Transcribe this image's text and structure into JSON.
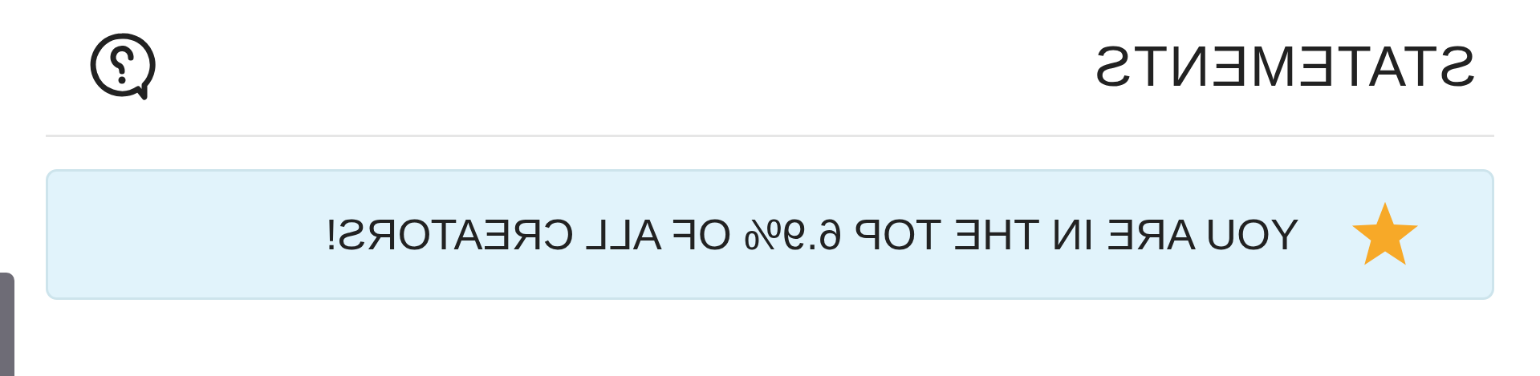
{
  "header": {
    "title": "STATEMENTS"
  },
  "banner": {
    "text": "YOU ARE IN THE TOP 6.9% OF ALL CREATORS!"
  }
}
